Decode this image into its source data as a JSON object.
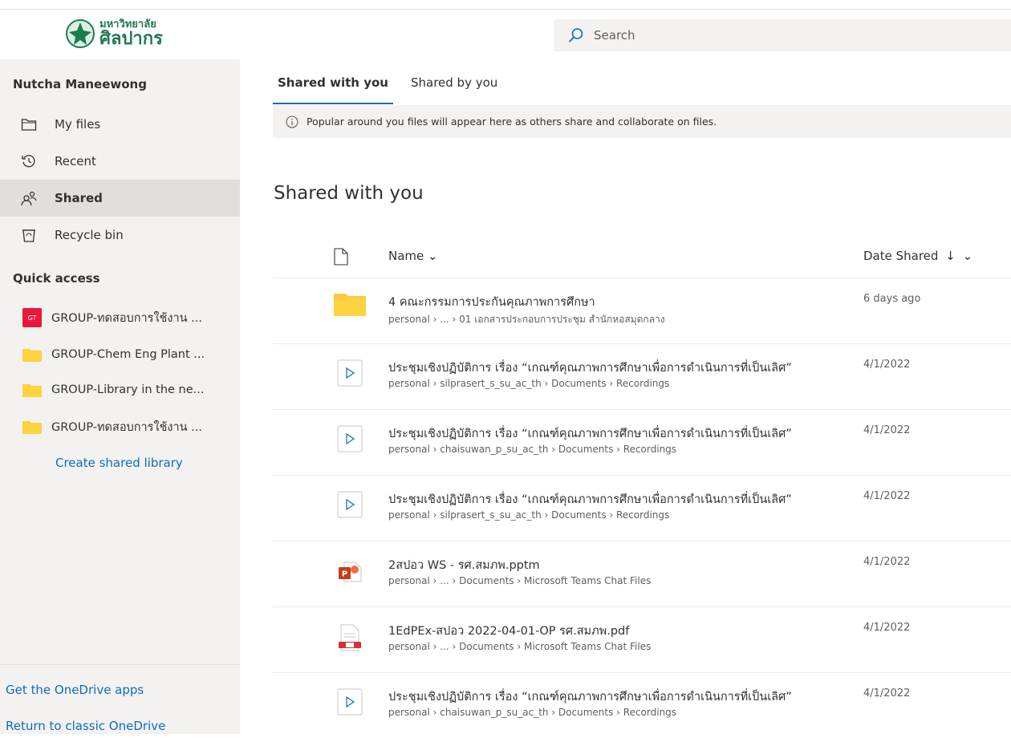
{
  "header": {
    "logo_line1": "มหาวิทยาลัย",
    "logo_line2": "ศิลปากร",
    "search_placeholder": "Search"
  },
  "sidebar": {
    "user_name": "Nutcha Maneewong",
    "nav": [
      {
        "label": "My files",
        "icon": "folder-outline-icon"
      },
      {
        "label": "Recent",
        "icon": "history-icon"
      },
      {
        "label": "Shared",
        "icon": "people-icon",
        "selected": true
      },
      {
        "label": "Recycle bin",
        "icon": "recycle-bin-icon"
      }
    ],
    "quick_access_title": "Quick access",
    "quick_access": [
      {
        "label": "GROUP-ทดสอบการใช้งาน ...",
        "icon": "gt-badge",
        "badge": "GT"
      },
      {
        "label": "GROUP-Chem Eng Plant ...",
        "icon": "folder-icon"
      },
      {
        "label": "GROUP-Library in the ne...",
        "icon": "folder-icon"
      },
      {
        "label": "GROUP-ทดสอบการใช้งาน ...",
        "icon": "folder-icon"
      }
    ],
    "create_library": "Create shared library",
    "get_apps": "Get the OneDrive apps",
    "return_classic": "Return to classic OneDrive"
  },
  "tabs": [
    {
      "label": "Shared with you",
      "active": true
    },
    {
      "label": "Shared by you",
      "active": false
    }
  ],
  "info_message": "Popular around you files will appear here as others share and collaborate on files.",
  "section_title": "Shared with you",
  "columns": {
    "name": "Name",
    "date": "Date Shared"
  },
  "files": [
    {
      "name": "4 คณะกรรมการประกันคุณภาพการศึกษา",
      "path": "personal › ... › 01 เอกสารประกอบการประชุม สำนักหอสมุดกลาง",
      "date": "6 days ago",
      "type": "folder"
    },
    {
      "name": "ประชุมเชิงปฏิบัติการ เรื่อง “เกณฑ์คุณภาพการศึกษาเพื่อการดำเนินการที่เป็นเลิศ”",
      "path": "personal › silprasert_s_su_ac_th › Documents › Recordings",
      "date": "4/1/2022",
      "type": "video"
    },
    {
      "name": "ประชุมเชิงปฏิบัติการ เรื่อง “เกณฑ์คุณภาพการศึกษาเพื่อการดำเนินการที่เป็นเลิศ”",
      "path": "personal › chaisuwan_p_su_ac_th › Documents › Recordings",
      "date": "4/1/2022",
      "type": "video"
    },
    {
      "name": "ประชุมเชิงปฏิบัติการ เรื่อง “เกณฑ์คุณภาพการศึกษาเพื่อการดำเนินการที่เป็นเลิศ”",
      "path": "personal › silprasert_s_su_ac_th › Documents › Recordings",
      "date": "4/1/2022",
      "type": "video"
    },
    {
      "name": "2สปอว WS - รศ.สมภพ.pptm",
      "path": "personal › ... › Documents › Microsoft Teams Chat Files",
      "date": "4/1/2022",
      "type": "pptm"
    },
    {
      "name": "1EdPEx-สปอว 2022-04-01-OP รศ.สมภพ.pdf",
      "path": "personal › ... › Documents › Microsoft Teams Chat Files",
      "date": "4/1/2022",
      "type": "pdf"
    },
    {
      "name": "ประชุมเชิงปฏิบัติการ เรื่อง “เกณฑ์คุณภาพการศึกษาเพื่อการดำเนินการที่เป็นเลิศ”",
      "path": "personal › chaisuwan_p_su_ac_th › Documents › Recordings",
      "date": "4/1/2022",
      "type": "video"
    }
  ],
  "colors": {
    "accent": "#0f6cbd",
    "sidebar_bg": "#f3f2f1",
    "folder": "#ffd23f",
    "ppt": "#c43e1c",
    "badge": "#e8173b"
  }
}
